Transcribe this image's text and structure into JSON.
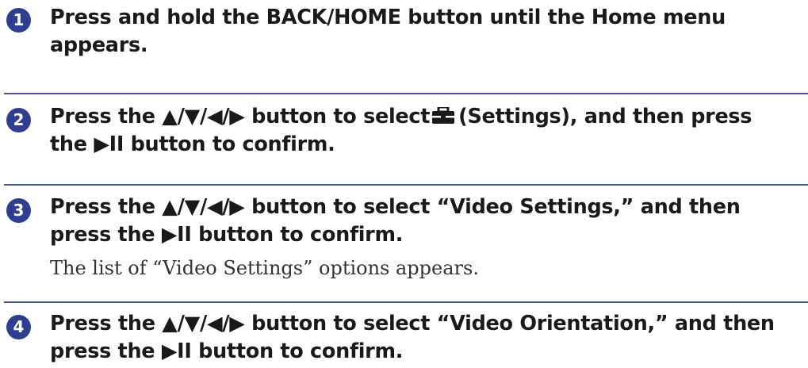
{
  "steps": [
    {
      "number": "1",
      "title": "Press and hold the BACK/HOME button until the Home menu appears."
    },
    {
      "number": "2",
      "title_before_icon": "Press the ▲/▼/◀/▶ button to select",
      "icon": "settings-toolbox-icon",
      "title_after_icon": "(Settings), and then press the ▶II button to confirm."
    },
    {
      "number": "3",
      "title": "Press the ▲/▼/◀/▶ button to select “Video Settings,” and then press the ▶II button to confirm.",
      "body": "The list of “Video Settings” options appears."
    },
    {
      "number": "4",
      "title": "Press the ▲/▼/◀/▶ button to select “Video Orientation,” and then press the ▶II button to confirm."
    }
  ],
  "colors": {
    "accent": "#2f3f8f",
    "divider": "#4a5590",
    "title_text": "#1a1a1a",
    "body_text": "#333333"
  }
}
